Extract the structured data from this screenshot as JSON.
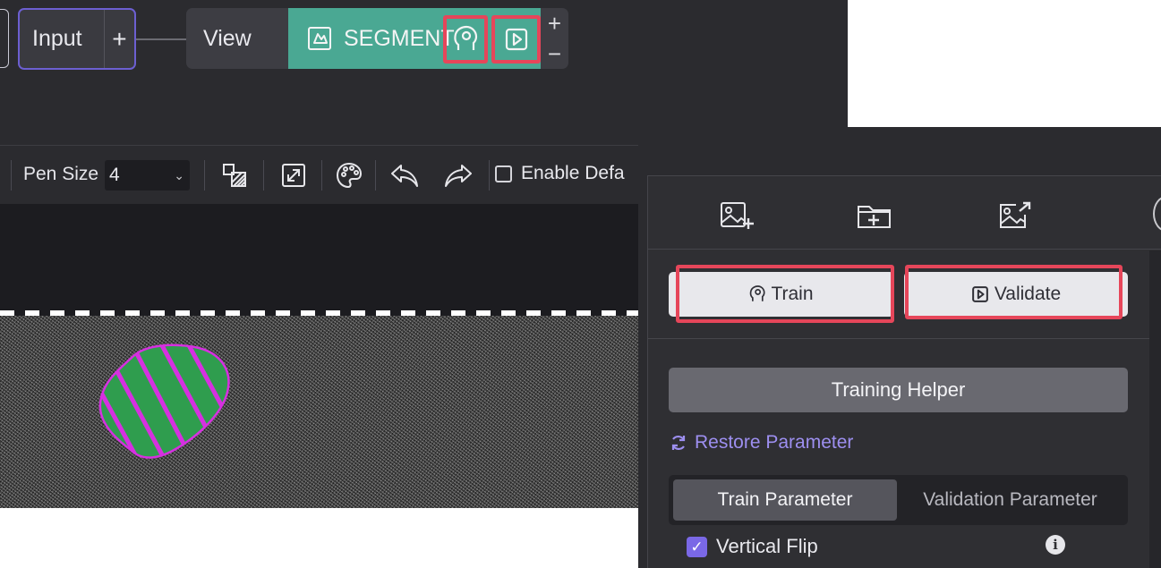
{
  "node_graph": {
    "input_node": {
      "label": "Input",
      "add_symbol": "+"
    },
    "view_node": {
      "label": "View"
    },
    "segment_node": {
      "label": "SEGMENT",
      "icon": "segment-icon",
      "actions": [
        "train-icon",
        "validate-icon"
      ]
    },
    "zoom": {
      "in": "+",
      "out": "−"
    }
  },
  "toolbar": {
    "pen_size_label": "Pen Size",
    "pen_size_value": "4",
    "icons": [
      "brush-fill-icon",
      "expand-icon",
      "palette-icon",
      "undo-icon",
      "redo-icon"
    ],
    "enable_default_label": "Enable Defa"
  },
  "right_panel": {
    "icons": [
      "add-image-icon",
      "add-folder-icon",
      "export-image-icon"
    ],
    "train_button": "Train",
    "validate_button": "Validate",
    "helper_button": "Training Helper",
    "restore_link": "Restore Parameter",
    "tabs": {
      "train": "Train Parameter",
      "validation": "Validation Parameter"
    },
    "vertical_flip": {
      "label": "Vertical Flip",
      "checked": true
    },
    "info_symbol": "i"
  },
  "colors": {
    "accent_purple": "#7a68e6",
    "segment_green": "#4aa893",
    "highlight_red": "#e6465a",
    "annotation_green": "#2f9d4e",
    "annotation_magenta": "#d630e0"
  }
}
